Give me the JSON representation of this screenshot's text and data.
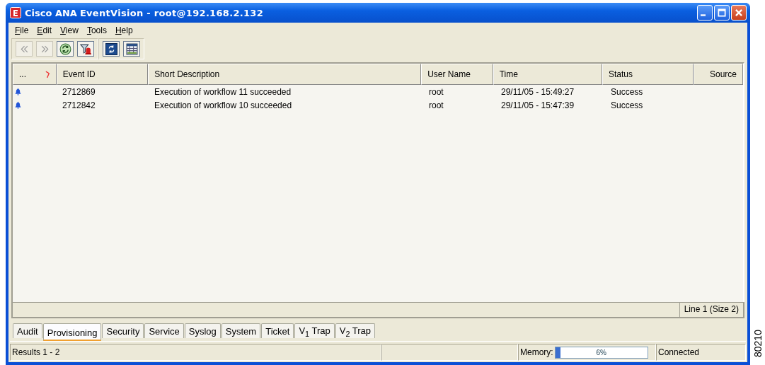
{
  "window": {
    "title_brand": "Cisco ANA",
    "title": "EventVision - root@192.168.2.132"
  },
  "menu": [
    "File",
    "Edit",
    "View",
    "Tools",
    "Help"
  ],
  "toolbar": [
    {
      "kind": "back",
      "disabled": true
    },
    {
      "kind": "forward",
      "disabled": true
    },
    {
      "kind": "refresh",
      "disabled": false
    },
    {
      "kind": "filter",
      "disabled": false
    },
    {
      "kind": "sync",
      "disabled": false
    },
    {
      "kind": "table",
      "disabled": false
    }
  ],
  "table": {
    "columns": [
      "...",
      "Event ID",
      "Short Description",
      "User Name",
      "Time",
      "Status",
      "Source"
    ],
    "rows": [
      {
        "event_id": "2712869",
        "short_description": "Execution of workflow 11 succeeded",
        "user_name": "root",
        "time": "29/11/05 - 15:49:27",
        "status": "Success"
      },
      {
        "event_id": "2712842",
        "short_description": "Execution of workflow 10 succeeded",
        "user_name": "root",
        "time": "29/11/05 - 15:47:39",
        "status": "Success"
      }
    ],
    "footer": "Line 1 (Size 2)"
  },
  "tabs": [
    {
      "label": "Audit",
      "selected": false
    },
    {
      "label": "Provisioning",
      "selected": true
    },
    {
      "label": "Security",
      "selected": false
    },
    {
      "label": "Service",
      "selected": false
    },
    {
      "label": "Syslog",
      "selected": false
    },
    {
      "label": "System",
      "selected": false
    },
    {
      "label": "Ticket",
      "selected": false
    },
    {
      "label": "V$_{1}$ Trap",
      "selected": false
    },
    {
      "label": "V$_{2}$ Trap",
      "selected": false
    }
  ],
  "status_bar": {
    "results": "Results 1 - 2",
    "memory_label": "Memory:",
    "memory": {
      "level": 0.06,
      "reading": "6%"
    },
    "connection": "Connected"
  },
  "figure_id": "80210"
}
